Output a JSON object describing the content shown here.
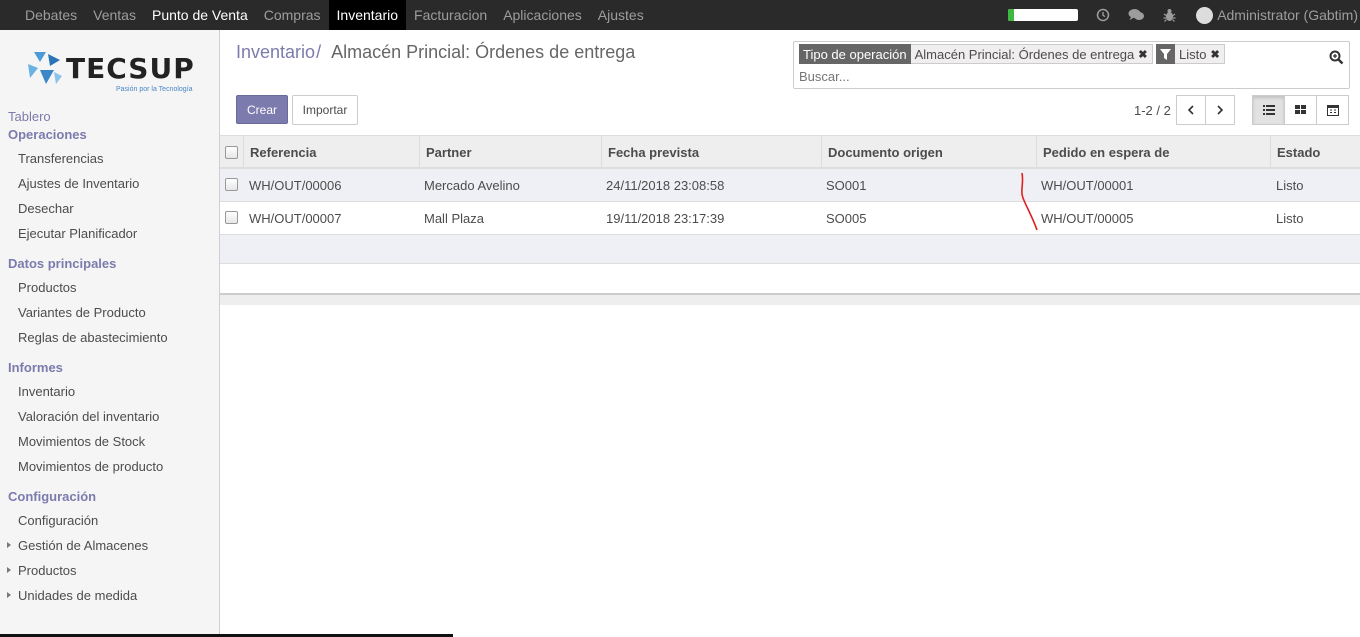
{
  "topbar": {
    "menu": [
      "Debates",
      "Ventas",
      "Punto de Venta",
      "Compras",
      "Inventario",
      "Facturacion",
      "Aplicaciones",
      "Ajustes"
    ],
    "progress_fraction": 0.08,
    "progress_color": "#3fb83f",
    "user": "Administrator (Gabtim)",
    "icons": [
      "clock-icon",
      "chat-icon",
      "bug-icon"
    ]
  },
  "logo": {
    "brand": "TECSUP",
    "tagline": "Pasión por la Tecnología"
  },
  "sidebar": {
    "tablero": "Tablero",
    "operaciones": {
      "title": "Operaciones",
      "items": [
        "Transferencias",
        "Ajustes de Inventario",
        "Desechar",
        "Ejecutar Planificador"
      ]
    },
    "datos": {
      "title": "Datos principales",
      "items": [
        "Productos",
        "Variantes de Producto",
        "Reglas de abastecimiento"
      ]
    },
    "informes": {
      "title": "Informes",
      "items": [
        "Inventario",
        "Valoración del inventario",
        "Movimientos de Stock",
        "Movimientos de producto"
      ]
    },
    "configuracion": {
      "title": "Configuración",
      "items": [
        "Configuración",
        "Gestión de Almacenes",
        "Productos",
        "Unidades de medida"
      ]
    }
  },
  "breadcrumb": {
    "parent": "Inventario",
    "separator": "/",
    "current": "Almacén Princial: Órdenes de entrega"
  },
  "search": {
    "facet1_label": "Tipo de operación",
    "facet1_value": "Almacén Princial: Órdenes de entrega",
    "facet2_value": "Listo",
    "placeholder": "Buscar..."
  },
  "buttons": {
    "create": "Crear",
    "import": "Importar"
  },
  "pager": {
    "value": "1-2 / 2"
  },
  "table": {
    "headers": [
      "Referencia",
      "Partner",
      "Fecha prevista",
      "Documento origen",
      "Pedido en espera de",
      "Estado"
    ],
    "rows": [
      [
        "WH/OUT/00006",
        "Mercado Avelino",
        "24/11/2018 23:08:58",
        "SO001",
        "WH/OUT/00001",
        "Listo"
      ],
      [
        "WH/OUT/00007",
        "Mall Plaza",
        "19/11/2018 23:17:39",
        "SO005",
        "WH/OUT/00005",
        "Listo"
      ]
    ]
  },
  "colors": {
    "accent": "#7c7bad",
    "topbar": "#2a2a2a",
    "annotation": "#e02020"
  }
}
